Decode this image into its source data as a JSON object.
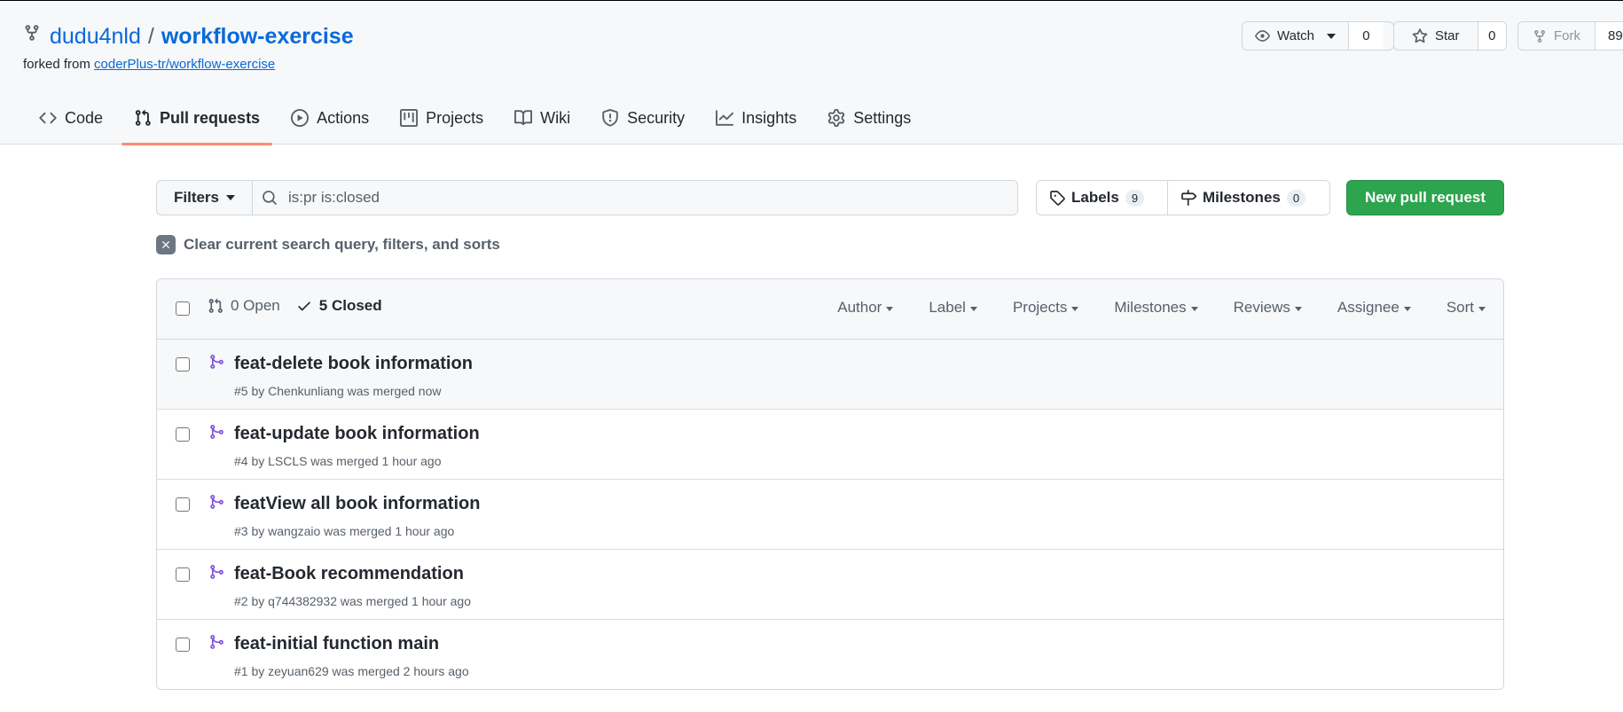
{
  "repo": {
    "owner": "dudu4nld",
    "separator": "/",
    "name": "workflow-exercise",
    "forked_from_prefix": "forked from",
    "forked_from_link": "coderPlus-tr/workflow-exercise"
  },
  "actions": {
    "watch_label": "Watch",
    "watch_count": "0",
    "star_label": "Star",
    "star_count": "0",
    "fork_label": "Fork",
    "fork_count": "89"
  },
  "tabs": [
    {
      "label": "Code",
      "icon": "code-icon"
    },
    {
      "label": "Pull requests",
      "icon": "git-pull-request-icon",
      "active": true
    },
    {
      "label": "Actions",
      "icon": "play-icon"
    },
    {
      "label": "Projects",
      "icon": "table-icon"
    },
    {
      "label": "Wiki",
      "icon": "book-icon"
    },
    {
      "label": "Security",
      "icon": "shield-icon"
    },
    {
      "label": "Insights",
      "icon": "graph-icon"
    },
    {
      "label": "Settings",
      "icon": "gear-icon"
    }
  ],
  "toolbar": {
    "filters_label": "Filters",
    "search_value": "is:pr is:closed",
    "labels_label": "Labels",
    "labels_count": "9",
    "milestones_label": "Milestones",
    "milestones_count": "0",
    "new_pr_label": "New pull request",
    "clear_label": "Clear current search query, filters, and sorts"
  },
  "list_header": {
    "open_label": "0 Open",
    "closed_label": "5 Closed",
    "filters": [
      "Author",
      "Label",
      "Projects",
      "Milestones",
      "Reviews",
      "Assignee",
      "Sort"
    ]
  },
  "pull_requests": [
    {
      "title": "feat-delete book information",
      "meta": "#5 by Chenkunliang was merged now"
    },
    {
      "title": "feat-update book information",
      "meta": "#4 by LSCLS was merged 1 hour ago"
    },
    {
      "title": "featView all book information",
      "meta": "#3 by wangzaio was merged 1 hour ago"
    },
    {
      "title": "feat-Book recommendation",
      "meta": "#2 by q744382932 was merged 1 hour ago"
    },
    {
      "title": "feat-initial function main",
      "meta": "#1 by zeyuan629 was merged 2 hours ago"
    }
  ],
  "colors": {
    "link": "#0969da",
    "primary_button": "#2da44e",
    "active_tab_underline": "#fd8c73",
    "merged": "#8250df"
  }
}
